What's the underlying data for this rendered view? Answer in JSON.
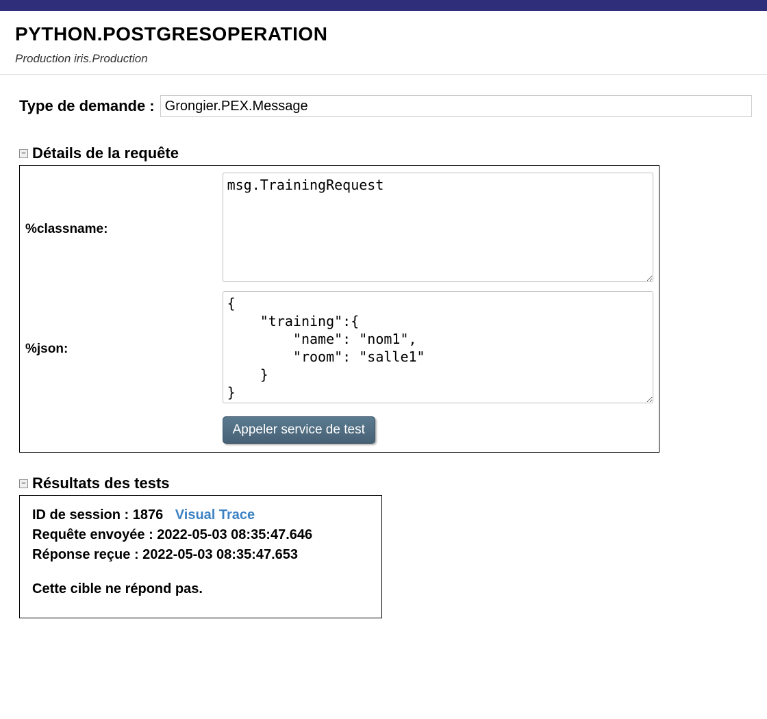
{
  "header": {
    "title": "PYTHON.POSTGRESOPERATION",
    "subtitle": "Production iris.Production"
  },
  "requestType": {
    "label": "Type de demande :",
    "value": "Grongier.PEX.Message"
  },
  "details": {
    "sectionTitle": "Détails de la requête",
    "classnameLabel": "%classname:",
    "classnameValue": "msg.TrainingRequest",
    "jsonLabel": "%json:",
    "jsonValue": "{\n    \"training\":{\n        \"name\": \"nom1\",\n        \"room\": \"salle1\"\n    }\n}",
    "testButton": "Appeler service de test"
  },
  "results": {
    "sectionTitle": "Résultats des tests",
    "sessionIdLabel": "ID de session :",
    "sessionId": "1876",
    "visualTrace": "Visual Trace",
    "requestSentLabel": "Requête envoyée :",
    "requestSentValue": "2022-05-03 08:35:47.646",
    "responseReceivedLabel": "Réponse reçue :",
    "responseReceivedValue": "2022-05-03 08:35:47.653",
    "message": "Cette cible ne répond pas."
  }
}
